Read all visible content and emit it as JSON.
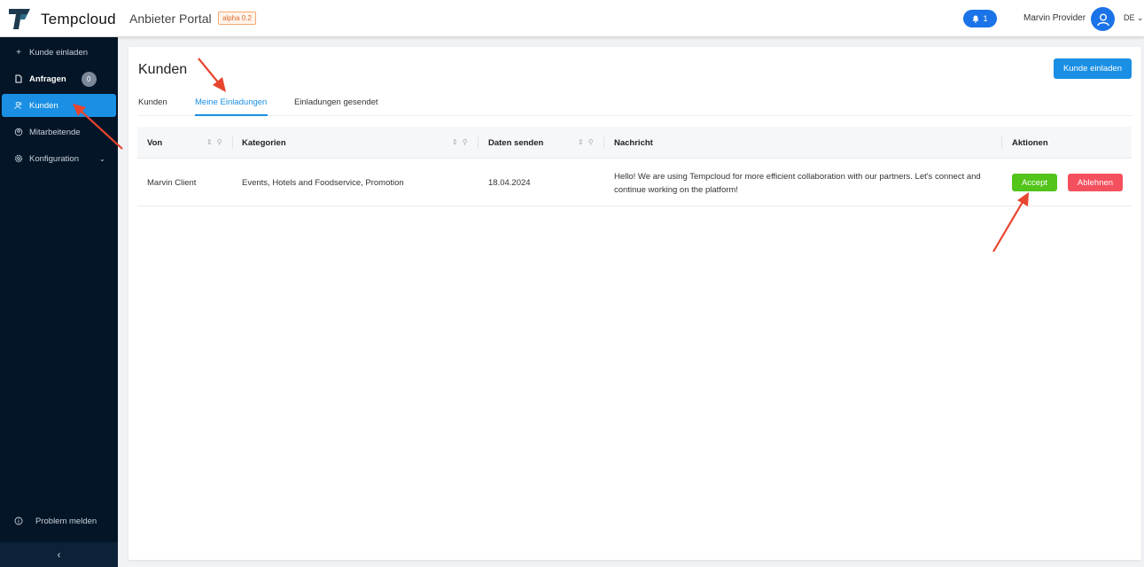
{
  "header": {
    "brand": "Tempcloud",
    "portal_title": "Anbieter Portal",
    "version_badge": "alpha 0.2",
    "notification_count": "1",
    "user_name": "Marvin Provider",
    "language": "DE"
  },
  "sidebar": {
    "items": [
      {
        "label": "Kunde einladen",
        "icon": "plus-icon"
      },
      {
        "label": "Anfragen",
        "icon": "document-icon",
        "badge": "0"
      },
      {
        "label": "Kunden",
        "icon": "users-icon"
      },
      {
        "label": "Mitarbeitende",
        "icon": "team-icon"
      },
      {
        "label": "Konfiguration",
        "icon": "gear-icon"
      }
    ],
    "report_problem": "Problem melden",
    "collapse_glyph": "‹"
  },
  "main": {
    "title": "Kunden",
    "invite_button": "Kunde einladen",
    "tabs": [
      "Kunden",
      "Meine Einladungen",
      "Einladungen gesendet"
    ],
    "active_tab": "Meine Einladungen",
    "table": {
      "columns": [
        "Von",
        "Kategorien",
        "Daten senden",
        "Nachricht",
        "Aktionen"
      ],
      "rows": [
        {
          "von": "Marvin Client",
          "kategorien": "Events, Hotels and Foodservice, Promotion",
          "datum": "18.04.2024",
          "nachricht": "Hello! We are using Tempcloud for more efficient collaboration with our partners. Let's connect and continue working on the platform!",
          "accept": "Accept",
          "reject": "Ablehnen"
        }
      ]
    }
  },
  "colors": {
    "primary": "#1a8fe3",
    "sidebar_bg": "#041527",
    "accept": "#52c41a",
    "reject": "#f5505d",
    "annotation": "#e8452f"
  }
}
